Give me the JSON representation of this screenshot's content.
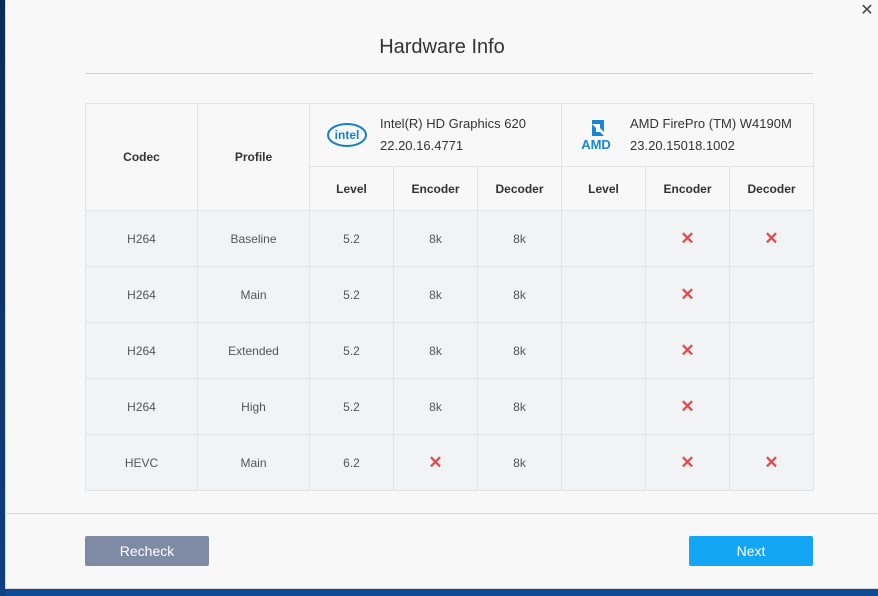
{
  "dialog": {
    "title": "Hardware Info",
    "close_icon": "✕"
  },
  "table": {
    "headers": {
      "codec": "Codec",
      "profile": "Profile"
    },
    "gpus": [
      {
        "vendor_logo": "intel-logo",
        "logo_text": "intel",
        "name": "Intel(R) HD Graphics 620",
        "version": "22.20.16.4771",
        "columns": [
          "Level",
          "Encoder",
          "Decoder"
        ]
      },
      {
        "vendor_logo": "amd-logo",
        "logo_text": "AMD",
        "name": "AMD FirePro (TM) W4190M",
        "version": "23.20.15018.1002",
        "columns": [
          "Level",
          "Encoder",
          "Decoder"
        ]
      }
    ],
    "unsupported_mark": "✕",
    "rows": [
      {
        "codec": "H264",
        "profile": "Baseline",
        "intel": {
          "level": "5.2",
          "encoder": "8k",
          "decoder": "8k"
        },
        "amd": {
          "level": "",
          "encoder": "✕",
          "decoder": "✕"
        }
      },
      {
        "codec": "H264",
        "profile": "Main",
        "intel": {
          "level": "5.2",
          "encoder": "8k",
          "decoder": "8k"
        },
        "amd": {
          "level": "",
          "encoder": "✕",
          "decoder": ""
        }
      },
      {
        "codec": "H264",
        "profile": "Extended",
        "intel": {
          "level": "5.2",
          "encoder": "8k",
          "decoder": "8k"
        },
        "amd": {
          "level": "",
          "encoder": "✕",
          "decoder": ""
        }
      },
      {
        "codec": "H264",
        "profile": "High",
        "intel": {
          "level": "5.2",
          "encoder": "8k",
          "decoder": "8k"
        },
        "amd": {
          "level": "",
          "encoder": "✕",
          "decoder": ""
        }
      },
      {
        "codec": "HEVC",
        "profile": "Main",
        "intel": {
          "level": "6.2",
          "encoder": "✕",
          "decoder": "8k"
        },
        "amd": {
          "level": "",
          "encoder": "✕",
          "decoder": "✕"
        }
      }
    ]
  },
  "footer": {
    "recheck_label": "Recheck",
    "next_label": "Next"
  },
  "colors": {
    "next_button": "#12a6f5",
    "recheck_button": "#7f8ba4",
    "unsupported": "#e34b4b",
    "intel_blue": "#1a7fc7",
    "amd_blue": "#1787d4"
  }
}
